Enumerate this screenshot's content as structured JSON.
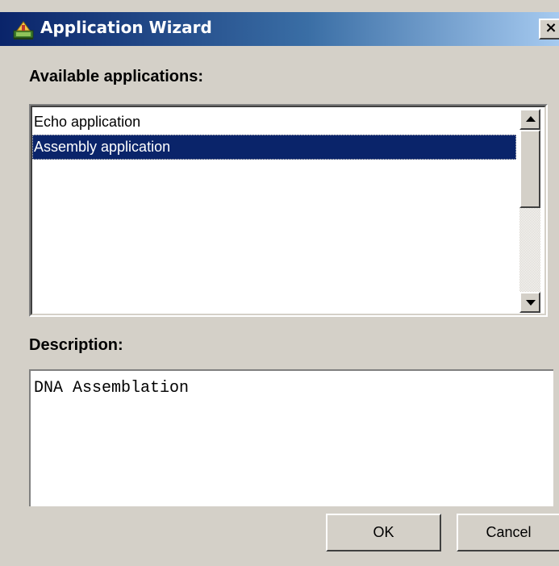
{
  "window": {
    "title": "Application Wizard",
    "close_glyph": "×",
    "icon": "application-wizard-icon"
  },
  "applications": {
    "label": "Available applications:",
    "items": [
      {
        "label": "Echo application",
        "selected": false
      },
      {
        "label": "Assembly application",
        "selected": true
      }
    ]
  },
  "description": {
    "label": "Description:",
    "text": "DNA Assemblation"
  },
  "buttons": {
    "ok_label": "OK",
    "cancel_label": "Cancel"
  },
  "colors": {
    "titlebar_start": "#0a246a",
    "titlebar_end": "#a6caf0",
    "selection": "#0a246a",
    "dialog_bg": "#d4d0c8"
  }
}
